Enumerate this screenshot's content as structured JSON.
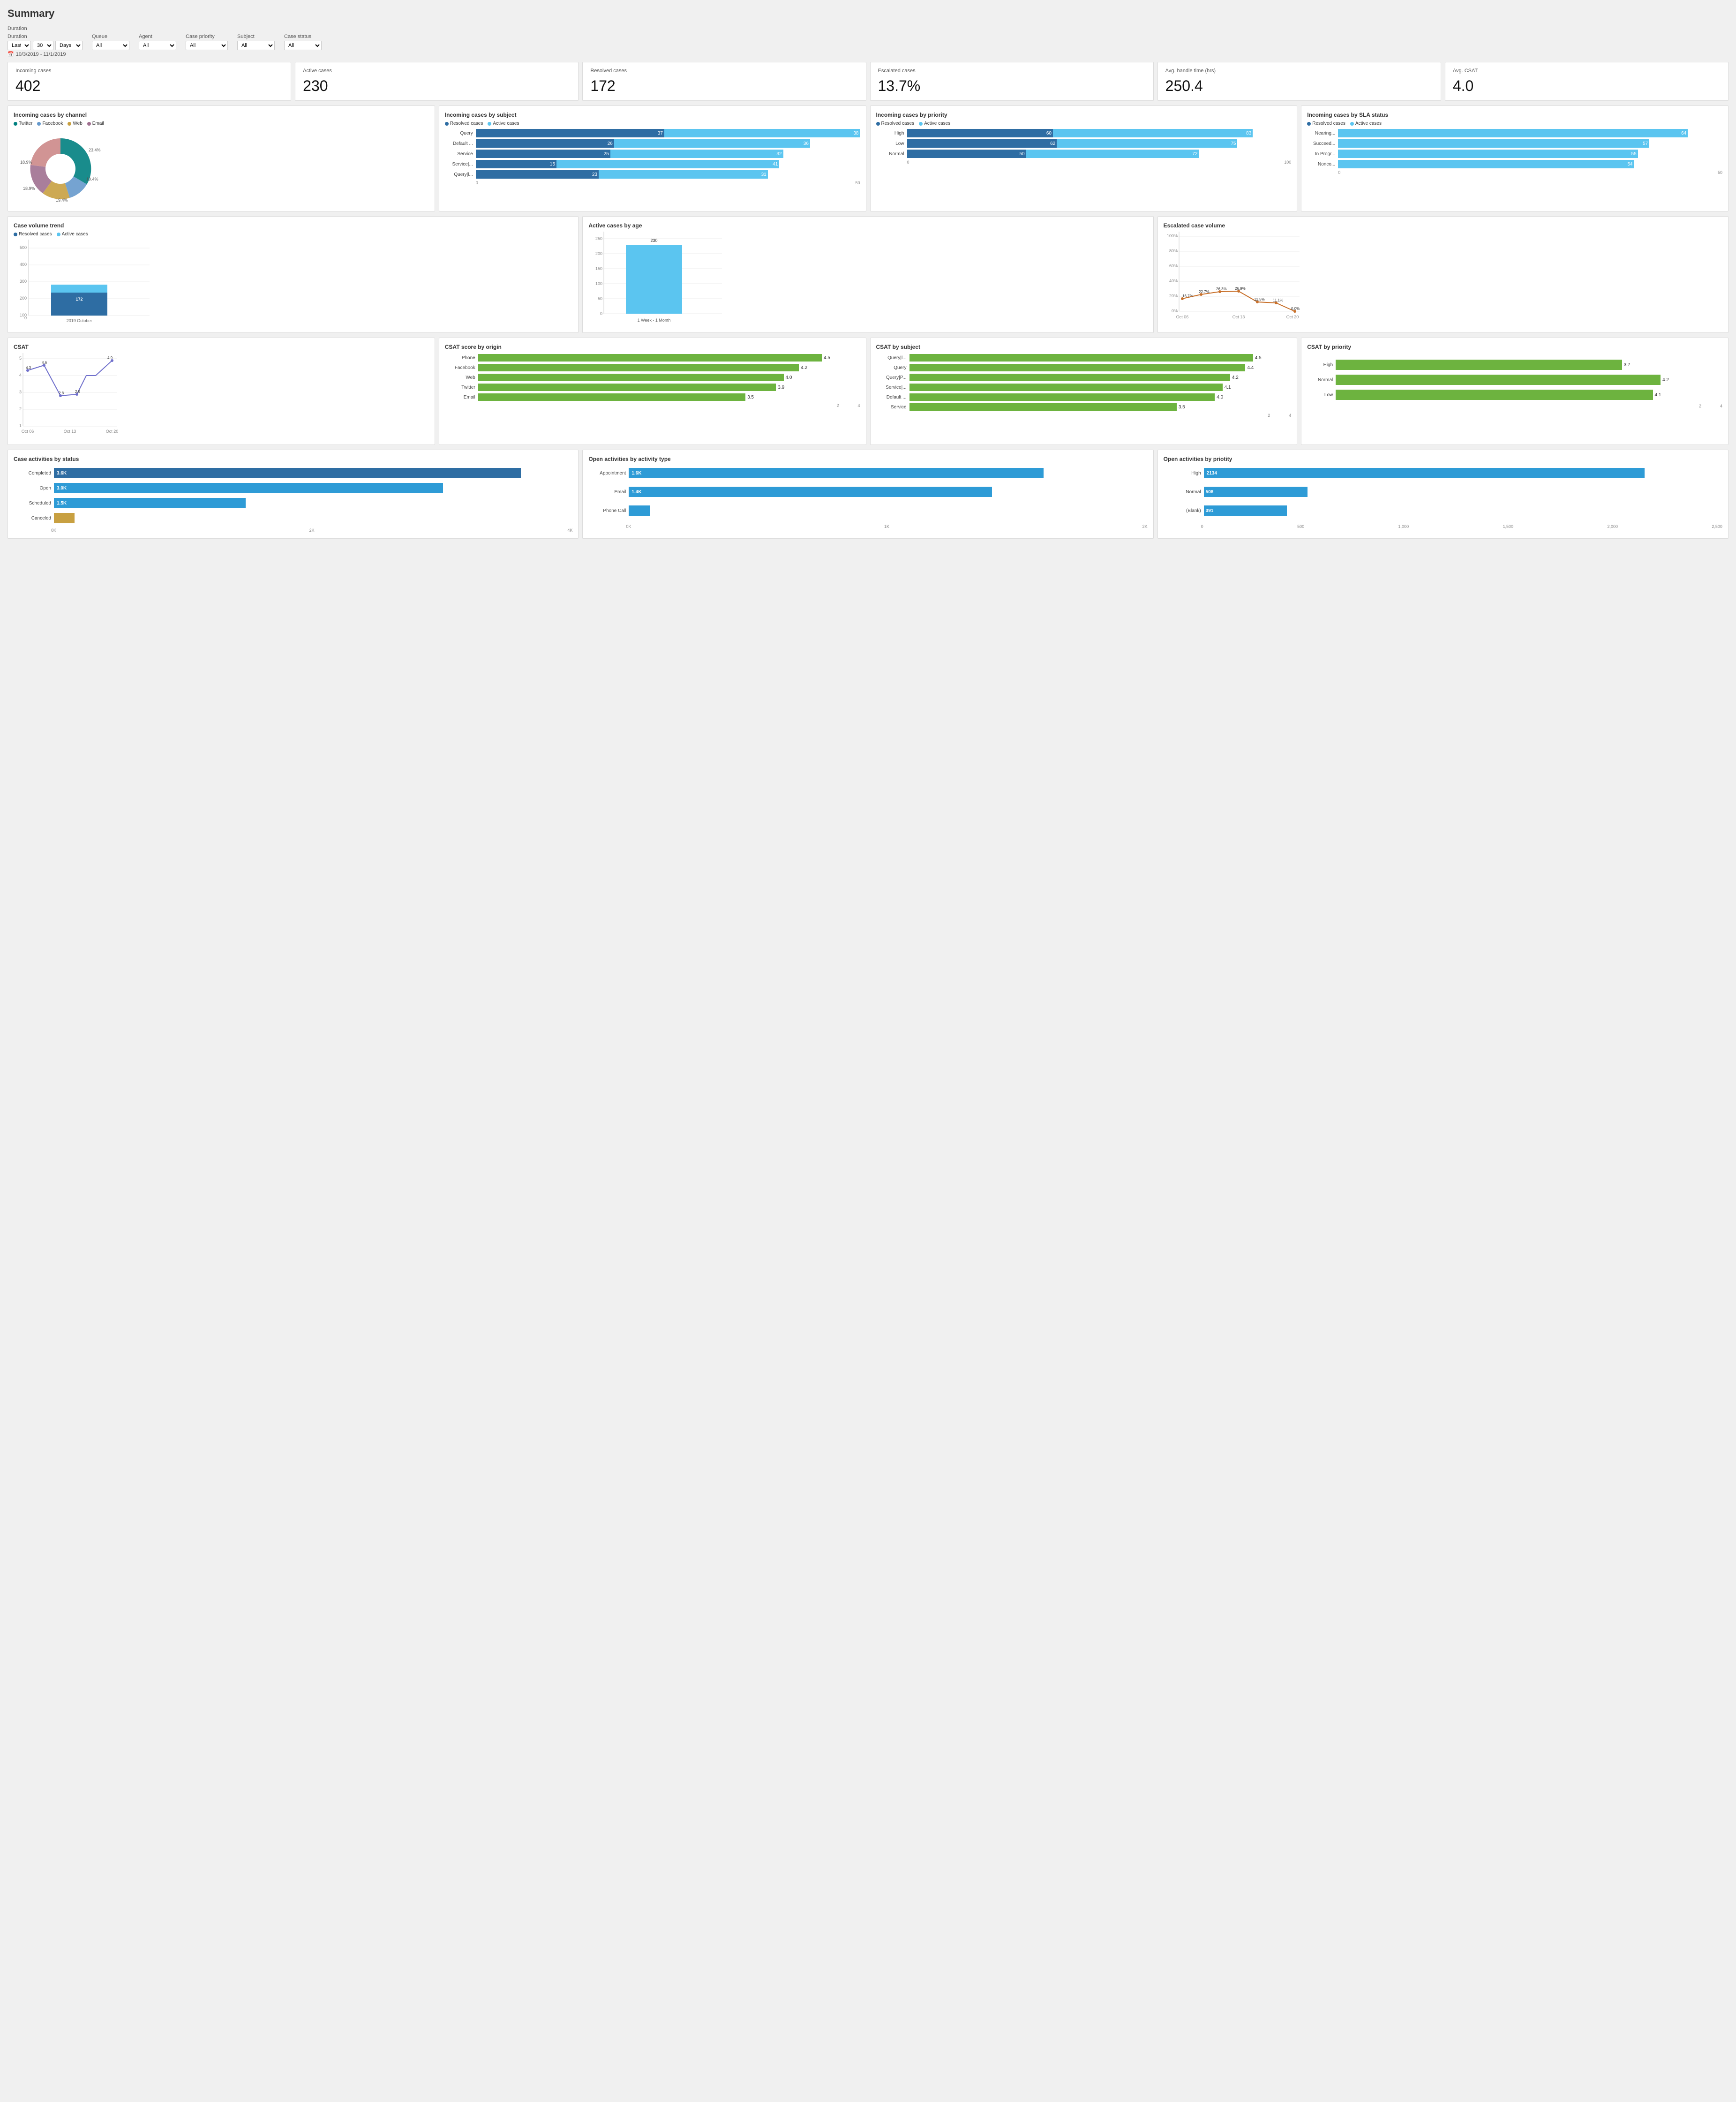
{
  "title": "Summary",
  "filters": {
    "duration_label": "Duration",
    "duration_preset": "Last",
    "duration_value": "30",
    "duration_unit": "Days",
    "queue_label": "Queue",
    "queue_value": "All",
    "agent_label": "Agent",
    "agent_value": "All",
    "case_priority_label": "Case priority",
    "case_priority_value": "All",
    "subject_label": "Subject",
    "subject_value": "All",
    "case_status_label": "Case status",
    "case_status_value": "All",
    "date_range": "10/3/2019 - 11/1/2019"
  },
  "kpis": [
    {
      "label": "Incoming cases",
      "value": "402"
    },
    {
      "label": "Active cases",
      "value": "230"
    },
    {
      "label": "Resolved cases",
      "value": "172"
    },
    {
      "label": "Escalated cases",
      "value": "13.7%"
    },
    {
      "label": "Avg. handle time (hrs)",
      "value": "250.4"
    },
    {
      "label": "Avg. CSAT",
      "value": "4.0"
    }
  ],
  "incoming_by_channel": {
    "title": "Incoming cases by channel",
    "legend": [
      "Twitter",
      "Facebook",
      "Web",
      "Email"
    ],
    "colors": [
      "#008080",
      "#6699cc",
      "#c8a041",
      "#a07090"
    ],
    "segments": [
      23.4,
      19.4,
      19.4,
      18.9,
      18.9
    ],
    "labels": [
      "23.4%",
      "19.4%",
      "19.4%",
      "18.9%",
      "18.9%"
    ]
  },
  "incoming_by_subject": {
    "title": "Incoming cases by subject",
    "legend_resolved": "Resolved cases",
    "legend_active": "Active cases",
    "rows": [
      {
        "label": "Query",
        "resolved": 37,
        "active": 38,
        "max": 80
      },
      {
        "label": "Default ...",
        "resolved": 26,
        "active": 36,
        "max": 80
      },
      {
        "label": "Service",
        "resolved": 25,
        "active": 32,
        "max": 80
      },
      {
        "label": "Service|...",
        "resolved": 15,
        "active": 41,
        "max": 80
      },
      {
        "label": "Query|l...",
        "resolved": 23,
        "active": 31,
        "max": 80
      }
    ],
    "axis_max": 50
  },
  "incoming_by_priority": {
    "title": "Incoming cases by priority",
    "legend_resolved": "Resolved cases",
    "legend_active": "Active cases",
    "rows": [
      {
        "label": "High",
        "resolved": 60,
        "active": 83,
        "max": 160
      },
      {
        "label": "Low",
        "resolved": 62,
        "active": 75,
        "max": 160
      },
      {
        "label": "Normal",
        "resolved": 50,
        "active": 72,
        "max": 160
      }
    ],
    "axis_max": 100
  },
  "incoming_by_sla": {
    "title": "Incoming cases by SLA status",
    "legend_resolved": "Resolved cases",
    "legend_active": "Active cases",
    "rows": [
      {
        "label": "Nearing...",
        "resolved": 0,
        "active": 64,
        "max": 70
      },
      {
        "label": "Succeed...",
        "resolved": 0,
        "active": 57,
        "max": 70
      },
      {
        "label": "In Progr...",
        "resolved": 0,
        "active": 55,
        "max": 70
      },
      {
        "label": "Nonco...",
        "resolved": 0,
        "active": 54,
        "max": 70
      }
    ],
    "axis_max": 50
  },
  "case_volume_trend": {
    "title": "Case volume trend",
    "legend_resolved": "Resolved cases",
    "legend_active": "Active cases",
    "month": "2019 October",
    "resolved": 172,
    "active": 230,
    "y_max": 500
  },
  "active_by_age": {
    "title": "Active cases by age",
    "value": 230,
    "x_label": "1 Week - 1 Month",
    "y_max": 250
  },
  "escalated_volume": {
    "title": "Escalated case volume",
    "x_labels": [
      "Oct 06",
      "Oct 13",
      "Oct 20"
    ],
    "points": [
      {
        "x": 0,
        "y": 16.7,
        "label": "16.7%"
      },
      {
        "x": 1,
        "y": 22.7,
        "label": "22.7%"
      },
      {
        "x": 2,
        "y": 26.3,
        "label": "26.3%"
      },
      {
        "x": 3,
        "y": 26.9,
        "label": "26.9%"
      },
      {
        "x": 4,
        "y": 12.5,
        "label": "12.5%"
      },
      {
        "x": 5,
        "y": 11.1,
        "label": "11.1%"
      },
      {
        "x": 6,
        "y": 0.0,
        "label": "0.0%"
      }
    ]
  },
  "csat": {
    "title": "CSAT",
    "x_labels": [
      "Oct 06",
      "Oct 13",
      "Oct 20"
    ],
    "y_labels": [
      "5",
      "4",
      "3",
      "2",
      "1"
    ],
    "points_x": [
      0,
      1,
      2,
      3,
      4,
      5,
      6
    ],
    "points_y": [
      4.3,
      4.6,
      2.8,
      2.9,
      4.0,
      4.0,
      4.9
    ],
    "annotations": [
      "4.3",
      "4.6",
      "2.8",
      "2.9",
      "4.9"
    ]
  },
  "csat_by_origin": {
    "title": "CSAT score by origin",
    "rows": [
      {
        "label": "Phone",
        "value": 4.5,
        "max": 5
      },
      {
        "label": "Facebook",
        "value": 4.2,
        "max": 5
      },
      {
        "label": "Web",
        "value": 4.0,
        "max": 5
      },
      {
        "label": "Twitter",
        "value": 3.9,
        "max": 5
      },
      {
        "label": "Email",
        "value": 3.5,
        "max": 5
      }
    ],
    "axis": [
      "2",
      "4"
    ]
  },
  "csat_by_subject": {
    "title": "CSAT by subject",
    "rows": [
      {
        "label": "Query|l...",
        "value": 4.5,
        "max": 5
      },
      {
        "label": "Query",
        "value": 4.4,
        "max": 5
      },
      {
        "label": "Query|P...",
        "value": 4.2,
        "max": 5
      },
      {
        "label": "Service|...",
        "value": 4.1,
        "max": 5
      },
      {
        "label": "Default ...",
        "value": 4.0,
        "max": 5
      },
      {
        "label": "Service",
        "value": 3.5,
        "max": 5
      }
    ],
    "axis": [
      "2",
      "4"
    ]
  },
  "csat_by_priority": {
    "title": "CSAT by priority",
    "rows": [
      {
        "label": "High",
        "value": 3.7,
        "max": 5
      },
      {
        "label": "Normal",
        "value": 4.2,
        "max": 5
      },
      {
        "label": "Low",
        "value": 4.1,
        "max": 5
      }
    ],
    "axis": [
      "2",
      "4"
    ]
  },
  "activities_by_status": {
    "title": "Case activities by status",
    "rows": [
      {
        "label": "Completed",
        "value": "3.6K",
        "raw": 3600,
        "max": 4000,
        "color": "#2E6DA3"
      },
      {
        "label": "Open",
        "value": "3.0K",
        "raw": 3000,
        "max": 4000,
        "color": "#2E9BD6"
      },
      {
        "label": "Scheduled",
        "value": "1.5K",
        "raw": 1500,
        "max": 4000,
        "color": "#2E9BD6"
      },
      {
        "label": "Canceled",
        "value": "",
        "raw": 150,
        "max": 4000,
        "color": "#c8a041"
      }
    ],
    "axis": [
      "0K",
      "2K",
      "4K"
    ]
  },
  "open_by_activity": {
    "title": "Open activities by activity type",
    "rows": [
      {
        "label": "Appointment",
        "value": "1.6K",
        "raw": 1600,
        "max": 2000,
        "color": "#2E9BD6"
      },
      {
        "label": "Email",
        "value": "1.4K",
        "raw": 1400,
        "max": 2000,
        "color": "#2E9BD6"
      },
      {
        "label": "Phone Call",
        "value": "",
        "raw": 80,
        "max": 2000,
        "color": "#2E9BD6"
      }
    ],
    "axis": [
      "0K",
      "1K",
      "2K"
    ]
  },
  "open_by_priority": {
    "title": "Open activities by priotity",
    "rows": [
      {
        "label": "High",
        "value": "2134",
        "raw": 2134,
        "max": 2500,
        "color": "#2E9BD6"
      },
      {
        "label": "Normal",
        "value": "508",
        "raw": 508,
        "max": 2500,
        "color": "#2E9BD6"
      },
      {
        "label": "(Blank)",
        "value": "391",
        "raw": 391,
        "max": 2500,
        "color": "#2E9BD6"
      }
    ],
    "axis": [
      "0",
      "500",
      "1,000",
      "1,500",
      "2,000",
      "2,500"
    ]
  },
  "colors": {
    "dark_blue": "#2E6DA3",
    "mid_blue": "#2E9BD6",
    "light_blue": "#5BC5F0",
    "green": "#6db33f",
    "orange": "#c8702a",
    "yellow": "#c8a041",
    "teal": "#008080",
    "purple": "#a07090",
    "resolved_color": "#2E6DA3",
    "active_color": "#5BC5F0"
  }
}
